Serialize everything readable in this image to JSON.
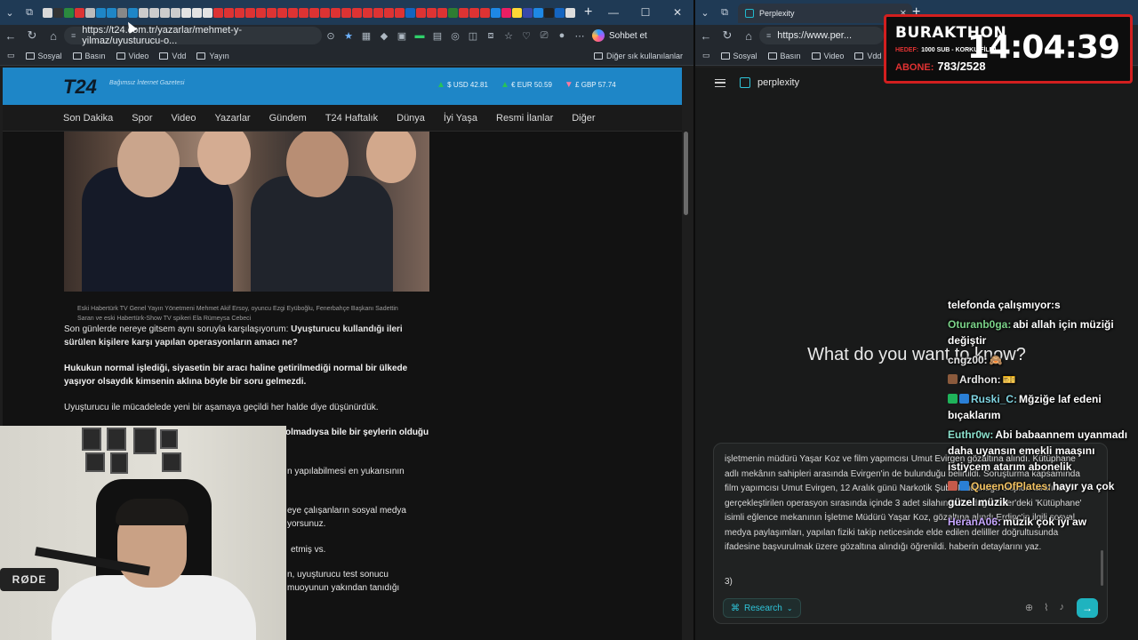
{
  "left_browser": {
    "url": "https://t24.com.tr/yazarlar/mehmet-y-yilmaz/uyusturucu-o...",
    "chat_button_label": "Sohbet et",
    "bookmarks": [
      "Sosyal",
      "Basın",
      "Video",
      "Vdd",
      "Yayın"
    ],
    "bookmarks_right": "Diğer sık kullanılanlar"
  },
  "site": {
    "logo": "T24",
    "tagline": "Bağımsız İnternet Gazetesi",
    "rates": [
      {
        "label": "$ USD 42.81",
        "dir": "up"
      },
      {
        "label": "€ EUR 50.59",
        "dir": "up"
      },
      {
        "label": "£ GBP 57.74",
        "dir": "down"
      }
    ],
    "nav": [
      "Son Dakika",
      "Spor",
      "Video",
      "Yazarlar",
      "Gündem",
      "T24 Haftalık",
      "Dünya",
      "İyi Yaşa",
      "Resmi İlanlar",
      "Diğer"
    ],
    "caption": "Eski Habertürk TV Genel Yayın Yönetmeni Mehmet Akif Ersoy, oyuncu Ezgi Eyüboğlu, Fenerbahçe Başkanı Sadettin Saran ve eski Habertürk-Show TV spikeri Ela Rümeysa Cebeci",
    "paragraphs": [
      {
        "normal": "Son günlerde nereye gitsem aynı soruyla karşılaşıyorum: ",
        "bold": "Uyuşturucu kullandığı ileri sürülen kişilere karşı yapılan operasyonların amacı ne?"
      },
      {
        "bold": "Hukukun normal işlediği, siyasetin bir aracı haline getirilmediği normal bir ülkede yaşıyor olsaydık kimsenin aklına böyle bir soru gelmezdi."
      },
      {
        "normal": "Uyuşturucu ile mücadelede yeni bir aşamaya geçildi her halde diye düşünürdük."
      }
    ],
    "fragments": [
      {
        "text": "olmadıysa bile bir şeylerin olduğu",
        "bold": true
      },
      {
        "text": "n yapılabilmesi en yukarısının",
        "bold": false
      },
      {
        "text": "eye çalışanların sosyal medya",
        "bold": false
      },
      {
        "text": "yorsunuz.",
        "bold": false
      },
      {
        "text": "etmiş vs.",
        "bold": false
      },
      {
        "text": "n, uyuşturucu test sonucu",
        "bold": false
      },
      {
        "text": "muoyunun yakından tanıdığı",
        "bold": false
      }
    ]
  },
  "webcam": {
    "mic_brand": "RØDE"
  },
  "right_browser": {
    "tab_title": "Perplexity",
    "url": "https://www.per..."
  },
  "perplexity": {
    "brand": "perplexity",
    "hero": "What do you want to know?",
    "query_text": "işletmenin müdürü Yaşar Koz ve film yapımcısı Umut Evirgen gözaltına alındı. Kütüphane adlı mekânın sahipleri arasında Evirgen'in de bulunduğu belirtildi. Soruşturma kapsamında film yapımcısı Umut Evirgen, 12 Aralık günü Narkotik Şube Müdürlüğü ekipleri tarafından gerçekleştirilen operasyon sırasında içinde 3 adet silahın bulunduğu Etiler'deki 'Kütüphane' isimli eğlence mekanının İşletme Müdürü Yaşar Koz, gözaltına alındı.Erdinç'in ilgili sosyal medya paylaşımları, yapılan fiziki takip neticesinde elde edilen delilller doğrultusunda ifadesine başvurulmak üzere gözaltına alındığı öğrenildi. haberin detaylarını yaz.",
    "query_suffix": "3)",
    "research_label": "Research"
  },
  "stream_chat": [
    {
      "user": "",
      "text": "telefonda çalışmıyor:s",
      "color": "#ffffff",
      "badge": ""
    },
    {
      "user": "Oturanb0ga:",
      "text": "abi allah için müziği değiştir",
      "color": "#7bd389",
      "badge": ""
    },
    {
      "user": "cngz00:",
      "text": "🙈",
      "color": "#e7e7e7",
      "badge": ""
    },
    {
      "user": "Ardhon:",
      "text": "🎫",
      "color": "#e7e7e7",
      "badge": "#8b5a3c"
    },
    {
      "user": "Ruski_C:",
      "text": "Mğziğe laf edeni bıçaklarım",
      "color": "#7fd3e0",
      "badge": "#1fb35a"
    },
    {
      "user": "Euthr0w:",
      "text": "Abi babaannem uyanmadı daha uyansın emekli maaşını istiycem atarım abonelik",
      "color": "#8be0cc",
      "badge": ""
    },
    {
      "user": "QueenOfPlates:",
      "text": "hayır ya çok güzel müzik",
      "color": "#f0c060",
      "badge": "#c65a4a"
    },
    {
      "user": "HeranA06:",
      "text": "müzik çok iyi aw",
      "color": "#c6a6ff",
      "badge": ""
    }
  ],
  "stream_overlay": {
    "channel": "BURAKTHON",
    "goal_label": "HEDEF:",
    "goal_value": "1000 SUB - KORKU FİLMİ",
    "sub_label": "ABONE:",
    "sub_value": "783/2528",
    "clock": "14:04:39"
  },
  "colors": {
    "t24_blue": "#1e86c7",
    "perplexity_accent": "#1fb3bf",
    "overlay_red": "#d21f1f"
  }
}
